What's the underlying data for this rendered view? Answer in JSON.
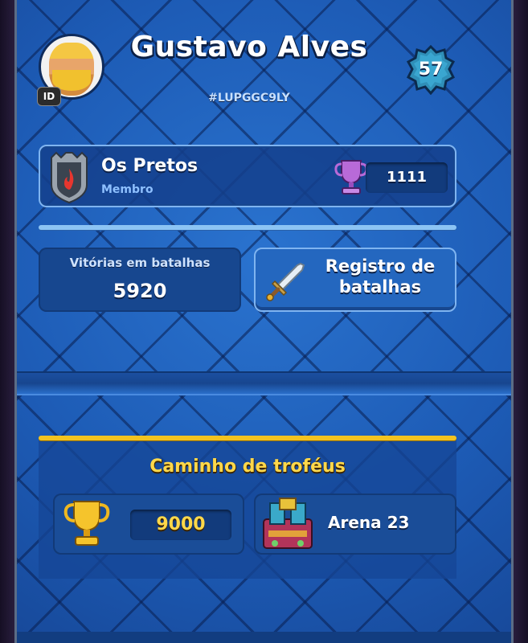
{
  "profile": {
    "name": "Gustavo Alves",
    "tag": "#LUPGGC9LY",
    "level": "57",
    "id_badge": "ID",
    "avatar_icon": "barbarian-avatar-icon"
  },
  "clan": {
    "name": "Os Pretos",
    "role": "Membro",
    "trophies": "1111",
    "badge_icon": "clan-shield-icon",
    "trophy_icon": "purple-trophy-icon"
  },
  "stats": {
    "wins_label": "Vitórias em batalhas",
    "wins_value": "5920",
    "battle_log_label": "Registro de\nbatalhas",
    "battle_log_icon": "sword-icon"
  },
  "trophy_road": {
    "title": "Caminho de troféus",
    "trophies": "9000",
    "arena": "Arena 23",
    "trophy_icon": "gold-trophy-icon",
    "arena_icon": "arena-icon"
  },
  "colors": {
    "panel_blue": "#1f5db6",
    "gold": "#ffd84a",
    "clan_role": "#8ec0ff"
  }
}
